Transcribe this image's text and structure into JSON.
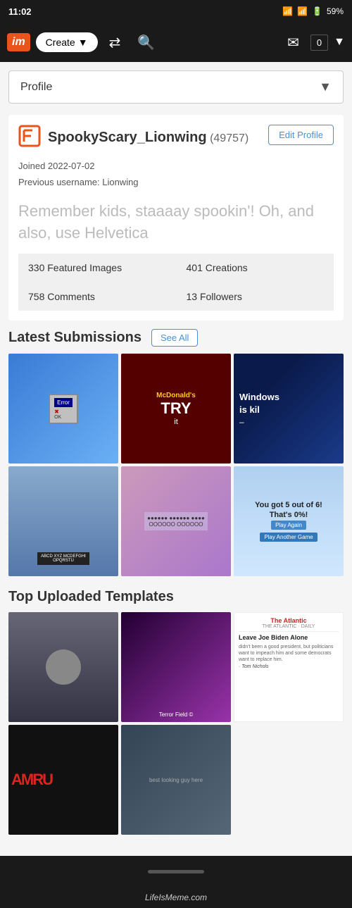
{
  "statusBar": {
    "time": "11:02",
    "battery": "59%"
  },
  "navBar": {
    "logoText": "im",
    "createLabel": "Create",
    "notifCount": "0"
  },
  "profileSelector": {
    "label": "Profile",
    "arrowChar": "▼"
  },
  "user": {
    "username": "SpookyScary_Lionwing",
    "points": "(49757)",
    "joinDate": "Joined 2022-07-02",
    "previousUsername": "Previous username: Lionwing",
    "editProfileLabel": "Edit Profile",
    "bio": "Remember kids, staaaay spookin'! Oh, and also, use Helvetica"
  },
  "stats": [
    {
      "label": "330 Featured Images"
    },
    {
      "label": "401 Creations"
    },
    {
      "label": "758 Comments"
    },
    {
      "label": "13 Followers"
    }
  ],
  "latestSubmissions": {
    "title": "Latest Submissions",
    "seeAllLabel": "See All"
  },
  "topTemplates": {
    "title": "Top Uploaded Templates"
  },
  "images": {
    "mcdonalds": "McDonald's",
    "tryText": "TRY",
    "windowsTitle": "Windows",
    "windowsKil": "is kil",
    "windowsDash": "–",
    "quizScore": "You got 5 out of 6!",
    "quizSubtitle": "That's 0%!",
    "quizPlayAgain": "Play Again",
    "quizPlayAnother": "Play Another Game",
    "atlanticLogo": "The Atlantic",
    "atlanticTagline": "THE ATLANTIC · DAILY",
    "atlanticHeadline": "Leave Joe Biden Alone",
    "atlanticBody": "didn't been a good president, but politicians want to impeach him and some democrats want to replace him.",
    "atlanticAuthor": "· Tom Nichols",
    "amogusText": "AMRU"
  },
  "bottomNav": {},
  "footer": {
    "text": "LifeIsMeme.com"
  }
}
